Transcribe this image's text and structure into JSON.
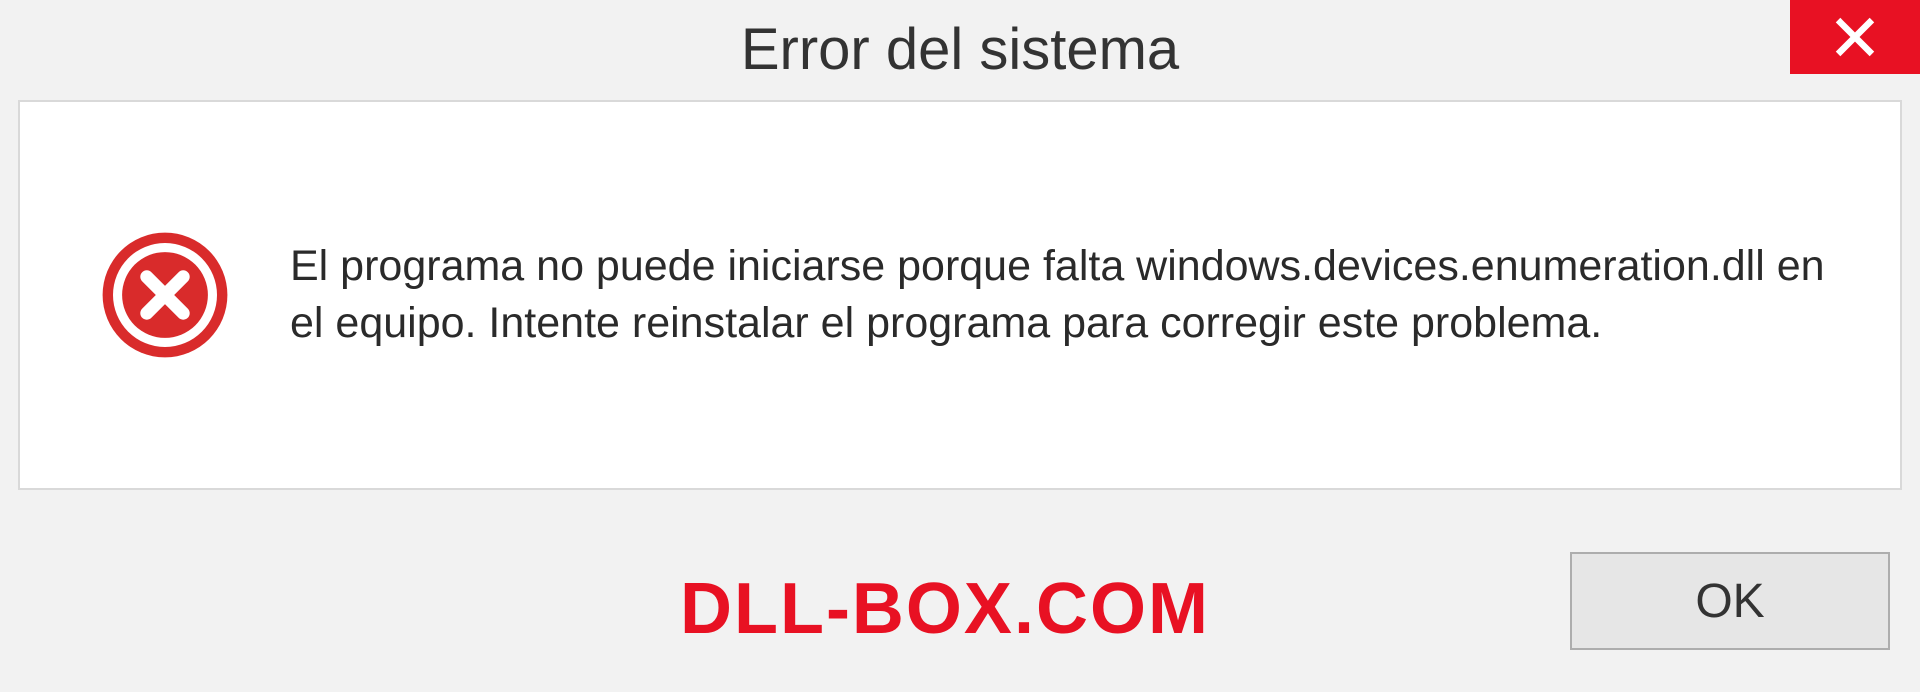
{
  "title": "Error del sistema",
  "message": "El programa no puede iniciarse porque falta windows.devices.enumeration.dll en el equipo. Intente reinstalar el programa para corregir este problema.",
  "ok_label": "OK",
  "watermark": "DLL-BOX.COM"
}
